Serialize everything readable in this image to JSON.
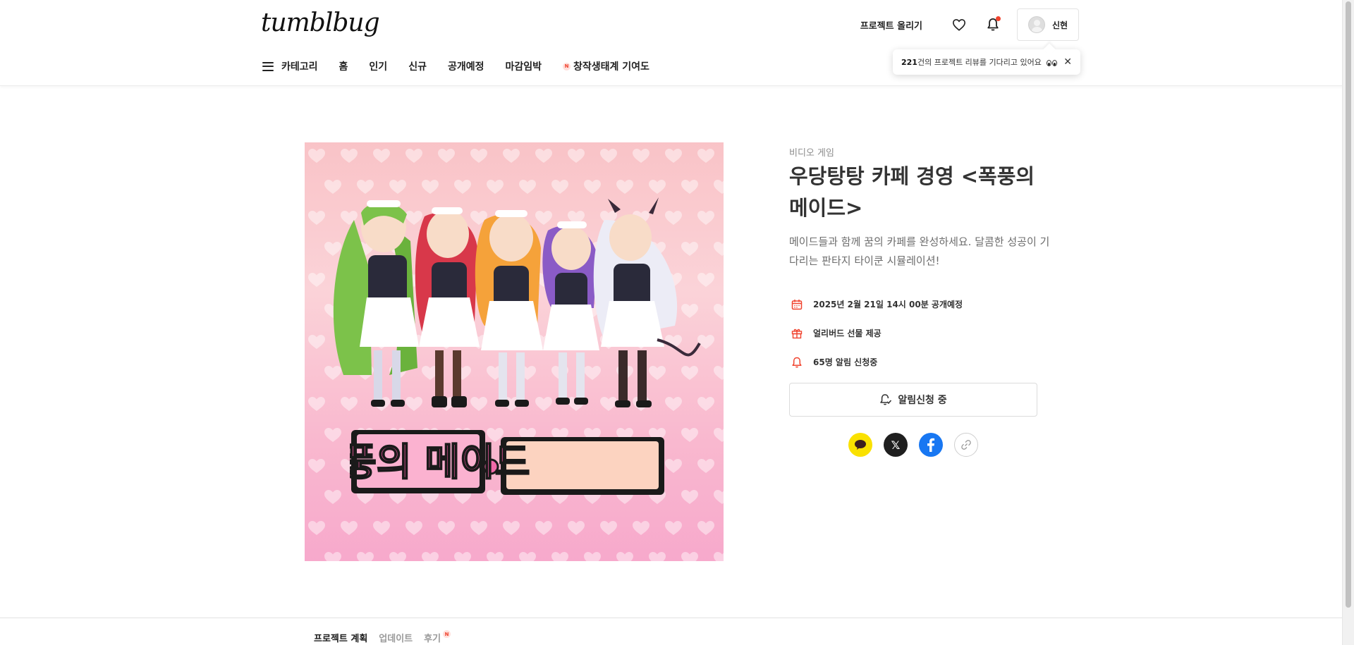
{
  "header": {
    "logo": "tumblbug",
    "upload_label": "프로젝트 올리기",
    "user_name": "신현"
  },
  "nav": {
    "items": [
      "카테고리",
      "홈",
      "인기",
      "신규",
      "공개예정",
      "마감임박"
    ],
    "featured_badge": "N",
    "featured_label": "창작생태계 기여도"
  },
  "tooltip": {
    "count": "221",
    "text": "건의 프로젝트 리뷰를 기다리고 있어요",
    "close": "✕"
  },
  "project": {
    "category": "비디오 게임",
    "title": "우당탕탕 카페 경영 <폭풍의 메이드>",
    "description": "메이드들과 함께 꿈의 카페를 완성하세요. 달콤한 성공이 기다리는 판타지 타이쿤 시뮬레이션!",
    "info": [
      {
        "icon": "calendar-icon",
        "text": "2025년 2월 21일 14시 00분 공개예정"
      },
      {
        "icon": "gift-icon",
        "text": "얼리버드 선물 제공"
      },
      {
        "icon": "bell-icon",
        "text": "65명 알림 신청중"
      }
    ],
    "notify_button": "알림신청 중",
    "hero_title": "폭풍의 메이드"
  },
  "share": {
    "x_label": "𝕏"
  },
  "tabs": [
    {
      "label": "프로젝트 계획",
      "active": true
    },
    {
      "label": "업데이트",
      "active": false
    },
    {
      "label": "후기",
      "active": false,
      "badge": "N"
    }
  ],
  "colors": {
    "accent_red": "#f0432e",
    "kakao": "#fae100",
    "facebook": "#1877f2"
  }
}
